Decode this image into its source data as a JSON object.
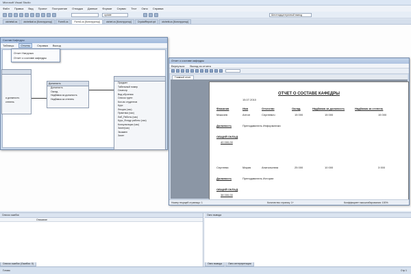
{
  "app": {
    "title": "Microsoft Visual Studio"
  },
  "menubar": [
    "Файл",
    "Правка",
    "Вид",
    "Проект",
    "Построение",
    "Отладка",
    "Данные",
    "Формат",
    "Сервис",
    "Тест",
    "Окно",
    "Справка"
  ],
  "toolbar": {
    "combo_value": "update",
    "output_combo": "Шестнадцатеричный вывод"
  },
  "doc_tabs": [
    {
      "label": "otchetsil.cs",
      "active": false
    },
    {
      "label": "otchetkaf.cs [Конструктор]",
      "active": false
    },
    {
      "label": "Form5.cs",
      "active": false
    },
    {
      "label": "Form1.cs [Конструктор]",
      "active": true
    },
    {
      "label": "otchet.cs [Конструктор]",
      "active": false
    },
    {
      "label": "CrystalReport.rpt",
      "active": false
    },
    {
      "label": "otchetk.cs [Конструктор]",
      "active": false
    }
  ],
  "form_window": {
    "title": "Состав Кафедры",
    "menu": [
      "Таблицы",
      "Отчеты",
      "Справка",
      "Выход"
    ],
    "dropdown": [
      "Отчет Нагрузка",
      "Отчет о составе кафедры"
    ],
    "entity_left_fields": [
      "а должность",
      "степень"
    ],
    "entity_position": {
      "title": "Должность",
      "fields": [
        "Должность",
        "Оклад",
        "Надбавка за должность",
        "Надбавка за степень"
      ]
    },
    "entity_big": {
      "fields": [
        "Предмет",
        "Табельный номер",
        "Семестр",
        "Вид обучения",
        "Список групп",
        "Кол-во студентов",
        "Курс",
        "Лекции (час)",
        "Практика (час)",
        "Лаб_Работы (час)",
        "Курс_Фондр работы (час)",
        "Консультации (час)",
        "Зачет(час)",
        "Экзамен",
        "Зачет"
      ]
    }
  },
  "report_window": {
    "title": "Отчет о составе кафедры",
    "menu": [
      "Вернуться",
      "Выход из отчета"
    ],
    "tab": "Главный отчет",
    "page": {
      "title": "ОТЧЕТ О СОСТАВЕ КАФЕДРЫ",
      "date": "15.07.2010",
      "headers": [
        "Фамилия",
        "Имя",
        "Отчество",
        "Оклад",
        "Надбавка за должность",
        "Надбавка за степень"
      ],
      "rows": [
        {
          "surname": "Максиев",
          "name": "Антон",
          "patronymic": "Сергеевич",
          "salary": "15 000",
          "pos_bonus": "15 000",
          "deg_bonus": "15 000",
          "position_label": "Должность",
          "position": "Преподаватель Информатики",
          "total_label": "ОБЩИЙ ОКЛАД",
          "total": "40 000,00"
        },
        {
          "surname": "Сергеева",
          "name": "Мария",
          "patronymic": "Анатольевна",
          "salary": "25 000",
          "pos_bonus": "10 000",
          "deg_bonus": "3 000",
          "position_label": "Должность",
          "position": "Преподаватель Истории",
          "total_label": "ОБЩИЙ ОКЛАД",
          "total": "38 000,00"
        }
      ]
    },
    "status": {
      "page_no": "Номер текущей страницы: 1",
      "page_count": "Количество страниц: 1+",
      "zoom": "Коэффициент масштабирования: 100%"
    }
  },
  "bottom": {
    "left_header": "Список ошибок",
    "left_cols": [
      "",
      "Описание"
    ],
    "right_header": "Окно вывода",
    "right_tabs": [
      "Окно вывода",
      "Окно интерпретации"
    ],
    "left_tabs": [
      "Список ошибок (Ошибок: 0)"
    ]
  },
  "statusbar": {
    "text": "Готово",
    "pos": "Стр 1"
  }
}
